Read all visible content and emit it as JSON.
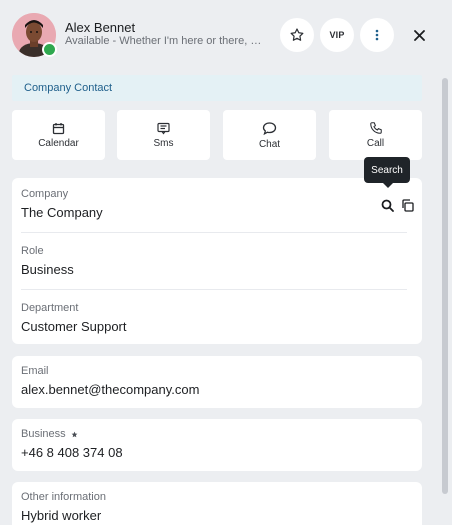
{
  "contact": {
    "name": "Alex Bennet",
    "status": "Available - Whether I'm here or there, still available"
  },
  "header": {
    "vip_label": "VIP"
  },
  "banner": {
    "label": "Company Contact"
  },
  "actions": [
    {
      "label": "Calendar",
      "icon": "calendar-icon"
    },
    {
      "label": "Sms",
      "icon": "sms-icon"
    },
    {
      "label": "Chat",
      "icon": "chat-icon"
    },
    {
      "label": "Call",
      "icon": "phone-icon"
    }
  ],
  "tooltip": {
    "label": "Search"
  },
  "details": {
    "company": {
      "label": "Company",
      "value": "The Company"
    },
    "role": {
      "label": "Role",
      "value": "Business"
    },
    "department": {
      "label": "Department",
      "value": "Customer Support"
    },
    "email": {
      "label": "Email",
      "value": "alex.bennet@thecompany.com"
    },
    "business": {
      "label": "Business",
      "value": "+46 8 408 374 08"
    },
    "other": {
      "label": "Other information",
      "value": "Hybrid worker"
    }
  },
  "colors": {
    "available": "#2fa84f",
    "banner_bg": "#e4f1f5",
    "banner_text": "#1f5f8b"
  }
}
